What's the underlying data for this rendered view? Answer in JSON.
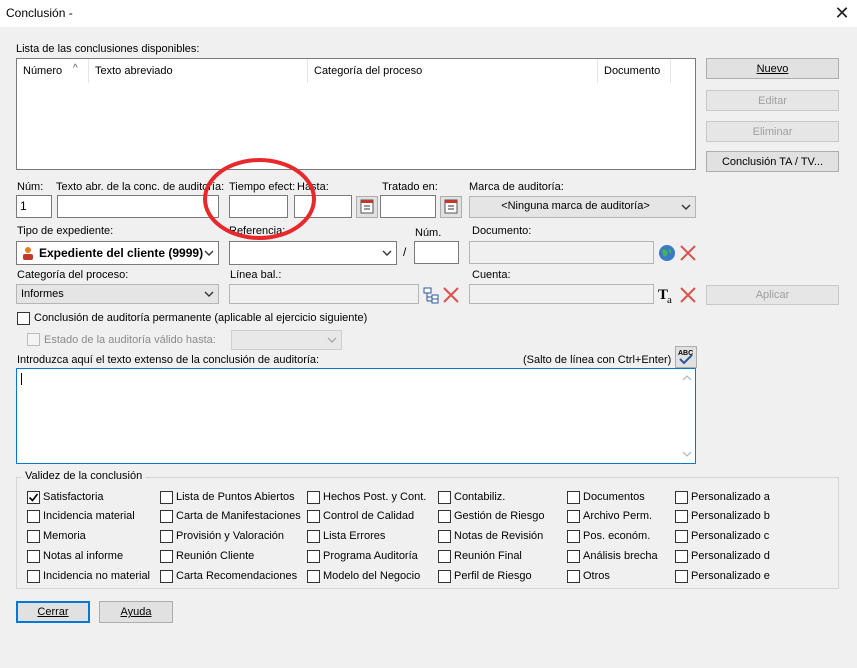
{
  "window": {
    "title": "Conclusión -",
    "close_glyph": "✕"
  },
  "list": {
    "label": "Lista de las conclusiones disponibles:",
    "columns": [
      "Número",
      "Texto abreviado",
      "Categoría del proceso",
      "Documento"
    ],
    "sort_glyph": "^"
  },
  "buttons": {
    "nuevo": "Nuevo",
    "editar": "Editar",
    "eliminar": "Eliminar",
    "conclusion_ta": "Conclusión TA / TV...",
    "aplicar": "Aplicar",
    "cerrar": "Cerrar",
    "ayuda": "Ayuda"
  },
  "fields": {
    "num_label": "Núm:",
    "num_value": "1",
    "texto_label": "Texto abr. de la conc. de auditoría:",
    "tiempo_label": "Tiempo efect:",
    "hasta_label": "Hasta:",
    "tratado_label": "Tratado en:",
    "marca_label": "Marca de auditoría:",
    "marca_value": "<Ninguna marca de auditoría>",
    "tipo_label": "Tipo de expediente:",
    "tipo_value": "Expediente del cliente (9999)",
    "referencia_label": "Referencia:",
    "slash": "/",
    "num2_label": "Núm.",
    "documento_label": "Documento:",
    "categoria_label": "Categoría del proceso:",
    "categoria_value": "Informes",
    "linea_label": "Línea bal.:",
    "cuenta_label": "Cuenta:",
    "permanente_label": "Conclusión de auditoría permanente (aplicable al ejercicio siguiente)",
    "estado_label": "Estado de la auditoría válido hasta:",
    "texto_ext_label": "Introduzca aquí el texto extenso de la conclusión de auditoría:",
    "salto_label": "(Salto de línea con Ctrl+Enter)"
  },
  "validez": {
    "title": "Validez de la conclusión",
    "columns": [
      [
        {
          "label": "Satisfactoria",
          "checked": true
        },
        {
          "label": "Incidencia material",
          "checked": false
        },
        {
          "label": "Memoria",
          "checked": false
        },
        {
          "label": "Notas al informe",
          "checked": false
        },
        {
          "label": "Incidencia no material",
          "checked": false
        }
      ],
      [
        {
          "label": "Lista de Puntos Abiertos",
          "checked": false
        },
        {
          "label": "Carta de Manifestaciones",
          "checked": false
        },
        {
          "label": "Provisión y Valoración",
          "checked": false
        },
        {
          "label": "Reunión Cliente",
          "checked": false
        },
        {
          "label": "Carta Recomendaciones",
          "checked": false
        }
      ],
      [
        {
          "label": "Hechos Post. y Cont.",
          "checked": false
        },
        {
          "label": "Control de Calidad",
          "checked": false
        },
        {
          "label": "Lista Errores",
          "checked": false
        },
        {
          "label": "Programa Auditoría",
          "checked": false
        },
        {
          "label": "Modelo del Negocio",
          "checked": false
        }
      ],
      [
        {
          "label": "Contabiliz.",
          "checked": false
        },
        {
          "label": "Gestión de Riesgo",
          "checked": false
        },
        {
          "label": "Notas de Revisión",
          "checked": false
        },
        {
          "label": "Reunión Final",
          "checked": false
        },
        {
          "label": "Perfil de Riesgo",
          "checked": false
        }
      ],
      [
        {
          "label": "Documentos",
          "checked": false
        },
        {
          "label": "Archivo Perm.",
          "checked": false
        },
        {
          "label": "Pos. económ.",
          "checked": false
        },
        {
          "label": "Análisis brecha",
          "checked": false
        },
        {
          "label": "Otros",
          "checked": false
        }
      ],
      [
        {
          "label": "Personalizado a",
          "checked": false
        },
        {
          "label": "Personalizado b",
          "checked": false
        },
        {
          "label": "Personalizado c",
          "checked": false
        },
        {
          "label": "Personalizado d",
          "checked": false
        },
        {
          "label": "Personalizado e",
          "checked": false
        }
      ]
    ]
  },
  "colors": {
    "accent": "#0078d7",
    "annotation": "#e8282b"
  }
}
